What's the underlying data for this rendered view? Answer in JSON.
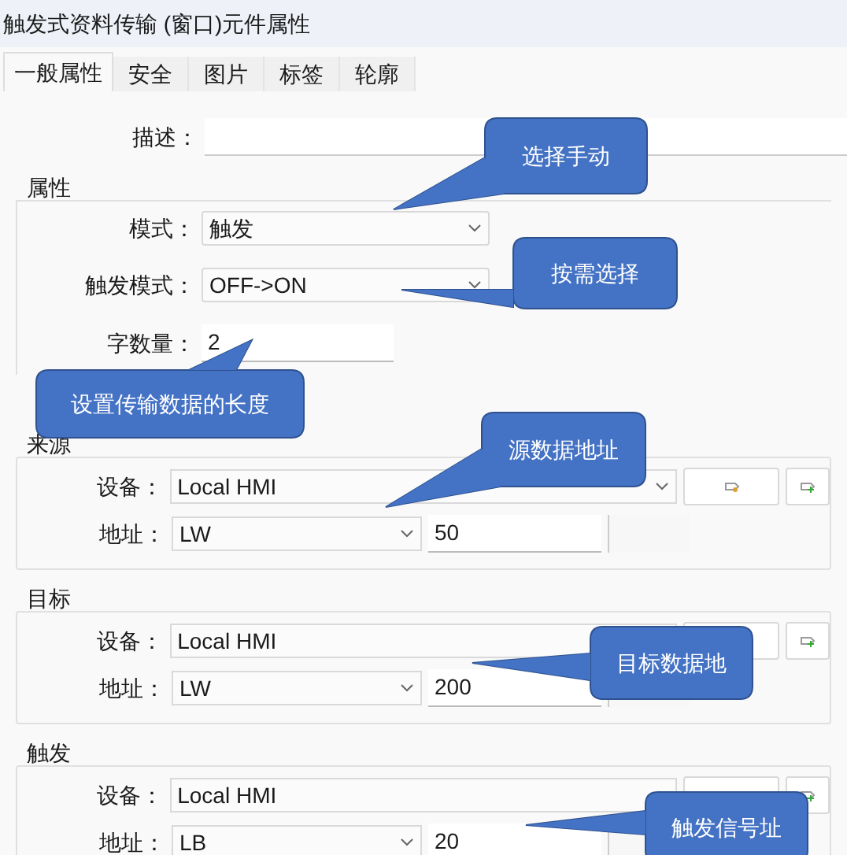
{
  "window": {
    "title": "触发式资料传输 (窗口)元件属性"
  },
  "tabs": [
    {
      "label": "一般属性",
      "selected": true
    },
    {
      "label": "安全",
      "selected": false
    },
    {
      "label": "图片",
      "selected": false
    },
    {
      "label": "标签",
      "selected": false
    },
    {
      "label": "轮廓",
      "selected": false
    }
  ],
  "description": {
    "label": "描述："
  },
  "properties": {
    "title": "属性",
    "fields": [
      {
        "kind": "select",
        "label": "模式：",
        "value": "触发"
      },
      {
        "kind": "select",
        "label": "触发模式：",
        "value": "OFF->ON"
      },
      {
        "kind": "input",
        "label": "字数量：",
        "value": "2"
      }
    ]
  },
  "sections": [
    {
      "title": "来源",
      "device_label": "设备：",
      "device": "Local HMI",
      "address_label": "地址：",
      "address_type": "LW",
      "address": "50"
    },
    {
      "title": "目标",
      "device_label": "设备：",
      "device": "Local HMI",
      "address_label": "地址：",
      "address_type": "LW",
      "address": "200"
    },
    {
      "title": "触发",
      "device_label": "设备：",
      "device": "Local HMI",
      "address_label": "地址：",
      "address_type": "LB",
      "address": "20"
    }
  ],
  "callouts": [
    "选择手动",
    "按需选择",
    "设置传输数据的长度",
    "源数据地址",
    "目标数据地",
    "触发信号址"
  ]
}
